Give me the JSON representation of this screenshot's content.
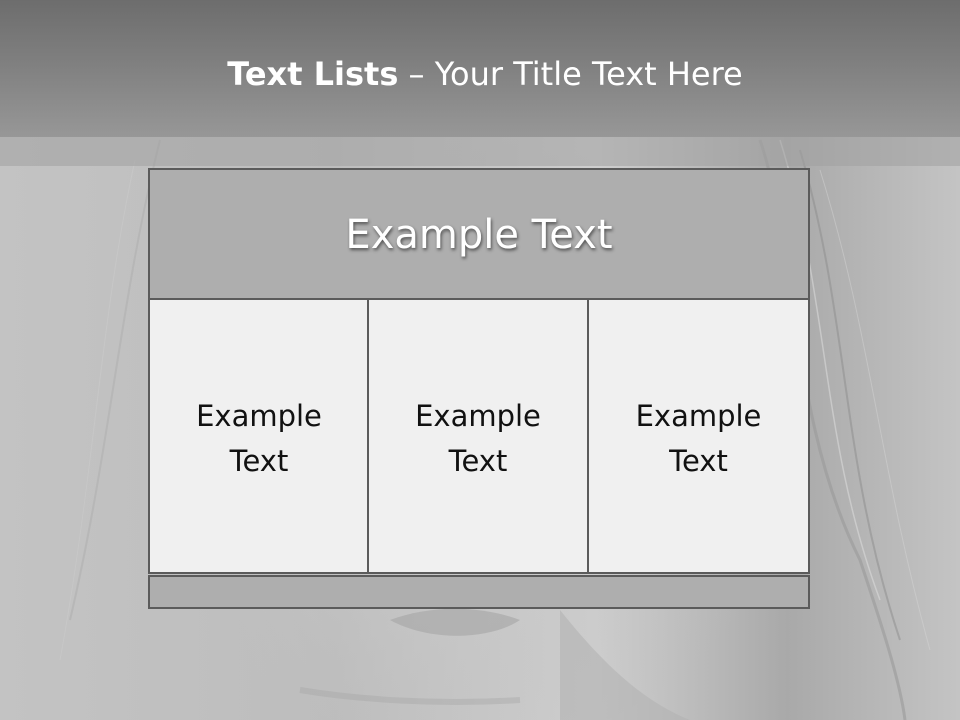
{
  "slide": {
    "title_bold": "Text Lists",
    "title_rest": " – Your Title Text Here",
    "diagram": {
      "header": "Example Text",
      "columns": [
        "Example Text",
        "Example Text",
        "Example Text"
      ]
    }
  },
  "colors": {
    "title_band": "#7f7f7f",
    "header_fill": "#aeaeae",
    "column_fill": "#f0f0f0",
    "border": "#5b5b5b",
    "title_text": "#ffffff"
  }
}
